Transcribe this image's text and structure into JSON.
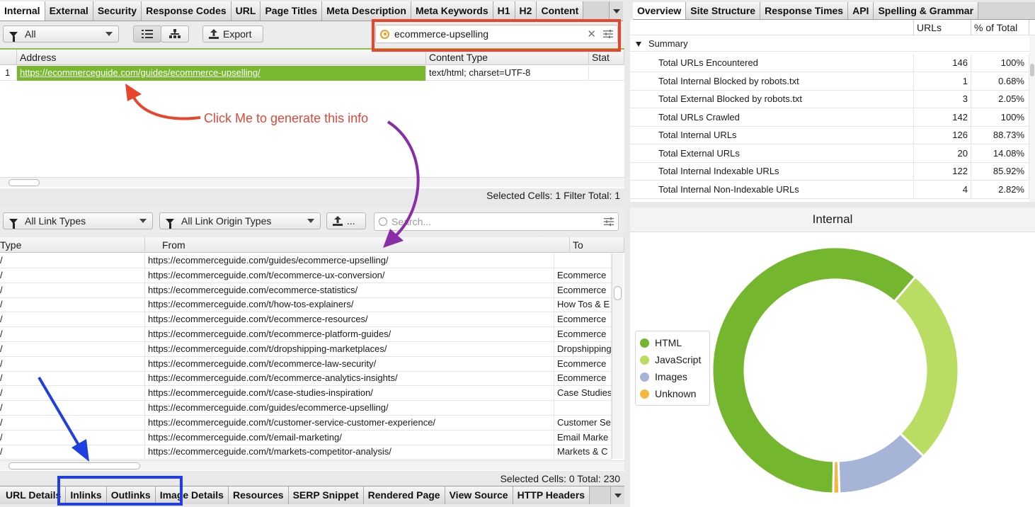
{
  "top_left": {
    "tabs": [
      "Internal",
      "External",
      "Security",
      "Response Codes",
      "URL",
      "Page Titles",
      "Meta Description",
      "Meta Keywords",
      "H1",
      "H2",
      "Content"
    ],
    "filter": "All",
    "export_label": "Export",
    "search_value": "ecommerce-upselling",
    "columns": [
      "Address",
      "Content Type",
      "Stat"
    ],
    "row": {
      "num": "1",
      "address": "https://ecommerceguide.com/guides/ecommerce-upselling/",
      "content_type": "text/html; charset=UTF-8"
    },
    "status": "Selected Cells: 1  Filter Total: 1"
  },
  "annotation_text": "Click Me to generate this info",
  "bottom_left": {
    "link_types": "All Link Types",
    "origin_types": "All Link Origin Types",
    "export_more": "...",
    "search_placeholder": "Search...",
    "columns": [
      "Type",
      "From",
      "To"
    ],
    "rows": [
      {
        "type": "/",
        "from": "https://ecommerceguide.com/guides/ecommerce-upselling/",
        "to": ""
      },
      {
        "type": "/",
        "from": "https://ecommerceguide.com/t/ecommerce-ux-conversion/",
        "to": "Ecommerce"
      },
      {
        "type": "/",
        "from": "https://ecommerceguide.com/ecommerce-statistics/",
        "to": "Ecommerce"
      },
      {
        "type": "/",
        "from": "https://ecommerceguide.com/t/how-tos-explainers/",
        "to": "How Tos & E"
      },
      {
        "type": "/",
        "from": "https://ecommerceguide.com/t/ecommerce-resources/",
        "to": "Ecommerce"
      },
      {
        "type": "/",
        "from": "https://ecommerceguide.com/t/ecommerce-platform-guides/",
        "to": "Ecommerce"
      },
      {
        "type": "/",
        "from": "https://ecommerceguide.com/t/dropshipping-marketplaces/",
        "to": "Dropshipping"
      },
      {
        "type": "/",
        "from": "https://ecommerceguide.com/t/ecommerce-law-security/",
        "to": "Ecommerce"
      },
      {
        "type": "/",
        "from": "https://ecommerceguide.com/t/ecommerce-analytics-insights/",
        "to": "Ecommerce"
      },
      {
        "type": "/",
        "from": "https://ecommerceguide.com/t/case-studies-inspiration/",
        "to": "Case Studies"
      },
      {
        "type": "/",
        "from": "https://ecommerceguide.com/guides/ecommerce-upselling/",
        "to": ""
      },
      {
        "type": "/",
        "from": "https://ecommerceguide.com/t/customer-service-customer-experience/",
        "to": "Customer Se"
      },
      {
        "type": "/",
        "from": "https://ecommerceguide.com/t/email-marketing/",
        "to": "Email Marke"
      },
      {
        "type": "/",
        "from": "https://ecommerceguide.com/t/markets-competitor-analysis/",
        "to": "Markets & C"
      }
    ],
    "status": "Selected Cells: 0  Total: 230",
    "bottom_tabs": [
      "URL Details",
      "Inlinks",
      "Outlinks",
      "Image Details",
      "Resources",
      "SERP Snippet",
      "Rendered Page",
      "View Source",
      "HTTP Headers"
    ]
  },
  "right": {
    "tabs": [
      "Overview",
      "Site Structure",
      "Response Times",
      "API",
      "Spelling & Grammar"
    ],
    "columns": [
      "URLs",
      "% of Total"
    ],
    "summary_label": "Summary",
    "rows": [
      {
        "label": "Total URLs Encountered",
        "urls": "146",
        "pct": "100%"
      },
      {
        "label": "Total Internal Blocked by robots.txt",
        "urls": "1",
        "pct": "0.68%"
      },
      {
        "label": "Total External Blocked by robots.txt",
        "urls": "3",
        "pct": "2.05%"
      },
      {
        "label": "Total URLs Crawled",
        "urls": "142",
        "pct": "100%"
      },
      {
        "label": "Total Internal URLs",
        "urls": "126",
        "pct": "88.73%"
      },
      {
        "label": "Total External URLs",
        "urls": "20",
        "pct": "14.08%"
      },
      {
        "label": "Total Internal Indexable URLs",
        "urls": "122",
        "pct": "85.92%"
      },
      {
        "label": "Total Internal Non-Indexable URLs",
        "urls": "4",
        "pct": "2.82%"
      }
    ],
    "chart_title": "Internal"
  },
  "chart_data": {
    "type": "pie",
    "title": "Internal",
    "categories": [
      "HTML",
      "JavaScript",
      "Images",
      "Unknown"
    ],
    "values": [
      61,
      26,
      12.2,
      0.8
    ],
    "colors": [
      "#74b62d",
      "#b9dc63",
      "#a6b4d7",
      "#f5b83d"
    ],
    "legend": "left"
  }
}
